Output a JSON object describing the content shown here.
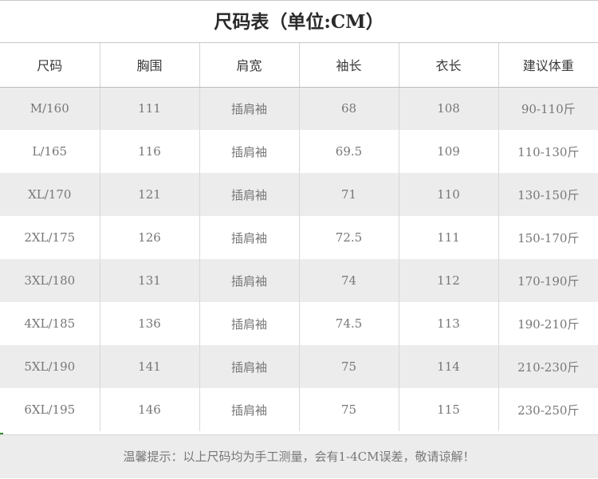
{
  "title": "尺码表（单位:CM）",
  "headers": [
    "尺码",
    "胸围",
    "肩宽",
    "袖长",
    "衣长",
    "建议体重"
  ],
  "rows": [
    [
      "M/160",
      "111",
      "插肩袖",
      "68",
      "108",
      "90-110斤"
    ],
    [
      "L/165",
      "116",
      "插肩袖",
      "69.5",
      "109",
      "110-130斤"
    ],
    [
      "XL/170",
      "121",
      "插肩袖",
      "71",
      "110",
      "130-150斤"
    ],
    [
      "2XL/175",
      "126",
      "插肩袖",
      "72.5",
      "111",
      "150-170斤"
    ],
    [
      "3XL/180",
      "131",
      "插肩袖",
      "74",
      "112",
      "170-190斤"
    ],
    [
      "4XL/185",
      "136",
      "插肩袖",
      "74.5",
      "113",
      "190-210斤"
    ],
    [
      "5XL/190",
      "141",
      "插肩袖",
      "75",
      "114",
      "210-230斤"
    ],
    [
      "6XL/195",
      "146",
      "插肩袖",
      "75",
      "115",
      "230-250斤"
    ]
  ],
  "note": "温馨提示：以上尺码均为手工测量，会有1-4CM误差，敬请谅解！",
  "colors": {
    "stripe": "#ececec",
    "text": "#777777",
    "header_text": "#3a3a3a"
  }
}
